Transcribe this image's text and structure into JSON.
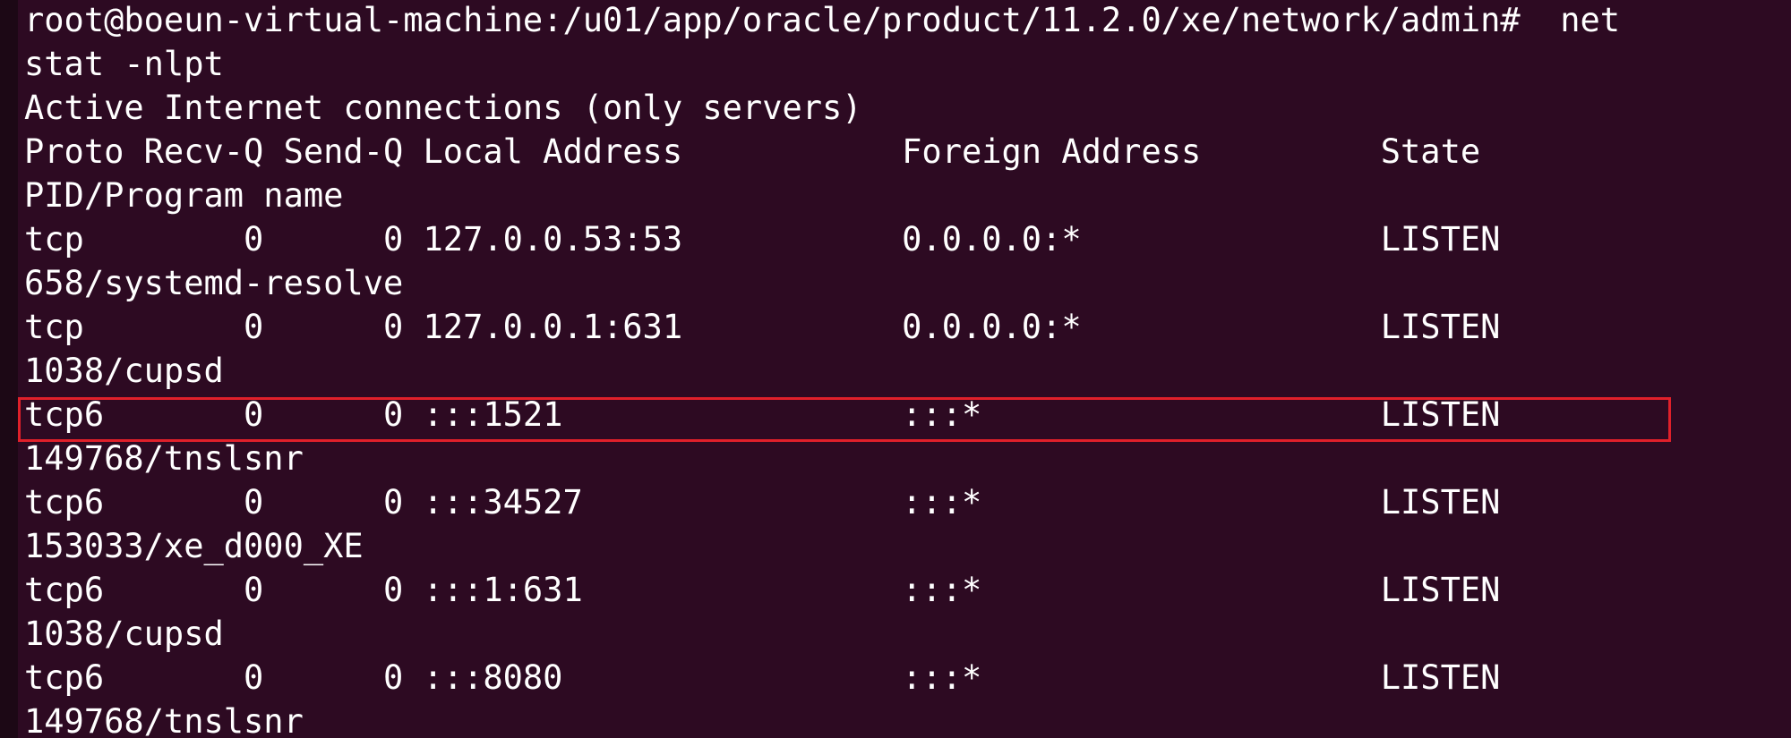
{
  "terminal": {
    "lines": [
      "root@boeun-virtual-machine:/u01/app/oracle/product/11.2.0/xe/network/admin#  net",
      "stat -nlpt",
      "Active Internet connections (only servers)",
      "Proto Recv-Q Send-Q Local Address           Foreign Address         State",
      "PID/Program name",
      "tcp        0      0 127.0.0.53:53           0.0.0.0:*               LISTEN",
      "658/systemd-resolve",
      "tcp        0      0 127.0.0.1:631           0.0.0.0:*               LISTEN",
      "1038/cupsd",
      "tcp6       0      0 :::1521                 :::*                    LISTEN",
      "149768/tnslsnr",
      "tcp6       0      0 :::34527                :::*                    LISTEN",
      "153033/xe_d000_XE",
      "tcp6       0      0 :::1:631                :::*                    LISTEN",
      "1038/cupsd",
      "tcp6       0      0 :::8080                 :::*                    LISTEN",
      "149768/tnslsnr"
    ],
    "highlight_color": "#e0202a",
    "background_color": "#2d0a22",
    "text_color": "#ffffff"
  }
}
